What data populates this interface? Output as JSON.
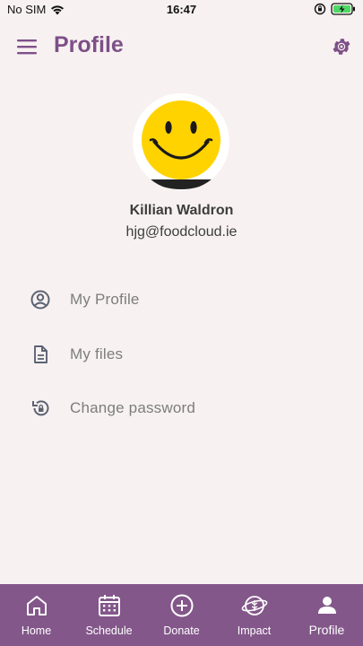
{
  "status_bar": {
    "carrier": "No SIM",
    "time": "16:47"
  },
  "header": {
    "title": "Profile"
  },
  "profile": {
    "name": "Killian Waldron",
    "email": "hjg@foodcloud.ie"
  },
  "menu": {
    "items": [
      {
        "label": "My Profile",
        "icon": "account-circle-icon"
      },
      {
        "label": "My files",
        "icon": "document-icon"
      },
      {
        "label": "Change password",
        "icon": "lock-reset-icon"
      }
    ]
  },
  "bottom_nav": {
    "items": [
      {
        "label": "Home",
        "icon": "home-icon"
      },
      {
        "label": "Schedule",
        "icon": "calendar-icon"
      },
      {
        "label": "Donate",
        "icon": "plus-circle-icon"
      },
      {
        "label": "Impact",
        "icon": "planet-icon"
      },
      {
        "label": "Profile",
        "icon": "person-icon",
        "active": true
      }
    ]
  },
  "colors": {
    "brand": "#7d5088",
    "nav_background": "#83578a",
    "background": "#f8f1f1",
    "muted_text": "#7d7d7d"
  }
}
